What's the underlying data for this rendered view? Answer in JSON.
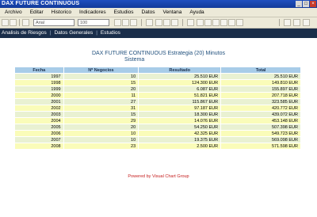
{
  "window": {
    "title": "DAX FUTURE CONTINUOUS"
  },
  "menu": {
    "items": [
      "Archivo",
      "Editar",
      "Historico",
      "Indicadores",
      "Estudios",
      "Datos",
      "Ventana",
      "Ayuda"
    ]
  },
  "toolbar": {
    "combo1": "Arial",
    "combo2": "100"
  },
  "nav": {
    "links": [
      "Analisis de Riesgos",
      "Datos Generales",
      "Estudios"
    ]
  },
  "report": {
    "title": "DAX FUTURE CONTINUOUS Estrategia (20) Minutos",
    "subtitle": "Sistema",
    "columns": [
      "Fecha",
      "Nº Negocios",
      "Resultado",
      "Total"
    ],
    "rows": [
      [
        "1997",
        "10",
        "25.510 EUR",
        "25.510 EUR"
      ],
      [
        "1998",
        "15",
        "124.300 EUR",
        "149.810 EUR"
      ],
      [
        "1999",
        "20",
        "6.087 EUR",
        "155.897 EUR"
      ],
      [
        "2000",
        "11",
        "51.821 EUR",
        "207.718 EUR"
      ],
      [
        "2001",
        "27",
        "115.867 EUR",
        "323.585 EUR"
      ],
      [
        "2002",
        "31",
        "97.187 EUR",
        "420.772 EUR"
      ],
      [
        "2003",
        "15",
        "18.300 EUR",
        "439.072 EUR"
      ],
      [
        "2004",
        "29",
        "14.076 EUR",
        "453.148 EUR"
      ],
      [
        "2005",
        "20",
        "54.250 EUR",
        "507.398 EUR"
      ],
      [
        "2006",
        "10",
        "42.325 EUR",
        "549.723 EUR"
      ],
      [
        "2007",
        "10",
        "19.375 EUR",
        "569.098 EUR"
      ],
      [
        "2008",
        "23",
        "2.500 EUR",
        "571.598 EUR"
      ]
    ]
  },
  "footer": {
    "text": "Powered by Visual Chart Group"
  }
}
